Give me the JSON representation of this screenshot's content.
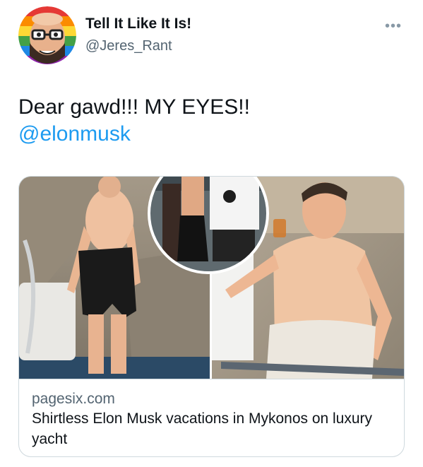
{
  "tweet": {
    "display_name": "Tell It Like It Is!",
    "handle": "@Jeres_Rant",
    "more_icon": "more-icon",
    "text": "Dear gawd!!!  MY EYES!!",
    "mention": "@elonmusk"
  },
  "card": {
    "domain": "pagesix.com",
    "title": "Shirtless Elon Musk vacations in Mykonos on luxury yacht"
  },
  "colors": {
    "link": "#1d9bf0",
    "secondary_text": "#536471",
    "border": "#cfd9de"
  }
}
